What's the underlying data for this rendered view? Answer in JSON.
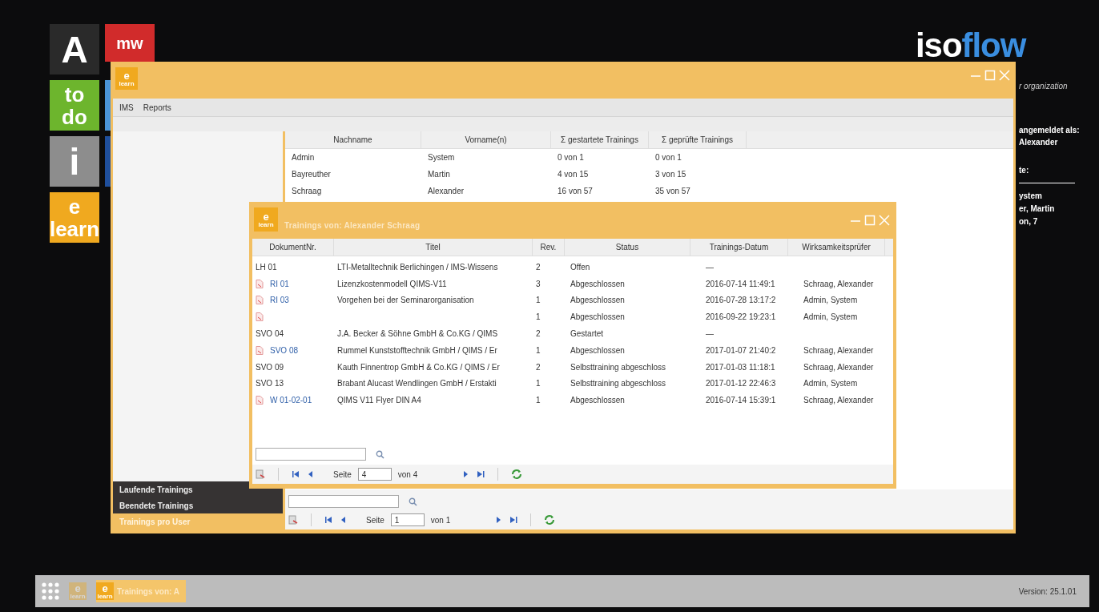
{
  "desktop": {
    "tiles": [
      {
        "lines": [
          "A"
        ],
        "color": "#2a2a2a"
      },
      {
        "lines": [
          "mw"
        ],
        "color": "#d12b2b"
      },
      {
        "lines": [
          "to",
          "do"
        ],
        "color": "#6db52d"
      },
      {
        "color": "#4b93d8"
      },
      {
        "lines": [
          "i"
        ],
        "color": "#8d8d8d"
      },
      {
        "color": "#1f4f9c"
      },
      {
        "lines": [
          "e",
          "learn"
        ],
        "color": "#f0a91f"
      }
    ],
    "logo": {
      "part_1": "iso",
      "part_2": "flow",
      "tagline": "r organization"
    },
    "side_panel": {
      "login_label": "angemeldet als:",
      "user": "Alexander",
      "section_title": "te:",
      "entries": [
        "ystem",
        "er, Martin",
        "on, 7"
      ]
    }
  },
  "main_window": {
    "icon": {
      "top": "e",
      "bottom": "learn"
    },
    "menu": [
      "IMS",
      "Reports"
    ],
    "table": {
      "columns": [
        "Nachname",
        "Vorname(n)",
        "Σ gestartete Trainings",
        "Σ geprüfte Trainings"
      ],
      "rows": [
        [
          "Admin",
          "System",
          "0 von 1",
          "0 von 1"
        ],
        [
          "Bayreuther",
          "Martin",
          "4 von 15",
          "3 von 15"
        ],
        [
          "Schraag",
          "Alexander",
          "16 von 57",
          "35 von 57"
        ]
      ]
    },
    "nav": [
      {
        "label": "Laufende Trainings",
        "selected": false
      },
      {
        "label": "Beendete Trainings",
        "selected": false
      },
      {
        "label": "Trainings pro User",
        "selected": true
      }
    ],
    "pager": {
      "label": "Seite",
      "page": "1",
      "of": "von 1"
    }
  },
  "child_window": {
    "icon": {
      "top": "e",
      "bottom": "learn"
    },
    "title": "Trainings von: Alexander Schraag",
    "table": {
      "columns": [
        "DokumentNr.",
        "Titel",
        "Rev.",
        "Status",
        "Trainings-Datum",
        "Wirksamkeitsprüfer"
      ],
      "rows": [
        {
          "linked": false,
          "doc": "LH 01",
          "title": "LTI-Metalltechnik Berlichingen / IMS-Wissens",
          "rev": "2",
          "status": "Offen",
          "date": "—"
        },
        {
          "linked": true,
          "doc": "RI 01",
          "title": "Lizenzkostenmodell QIMS-V11",
          "rev": "3",
          "status": "Abgeschlossen",
          "date": "2016-07-14 11:49:1",
          "checker": "Schraag, Alexander"
        },
        {
          "linked": true,
          "doc": "RI 03",
          "title": "Vorgehen bei der Seminarorganisation",
          "rev": "1",
          "status": "Abgeschlossen",
          "date": "2016-07-28 13:17:2",
          "checker": "Admin, System"
        },
        {
          "linked": true,
          "rev": "1",
          "status": "Abgeschlossen",
          "date": "2016-09-22 19:23:1",
          "checker": "Admin, System"
        },
        {
          "linked": false,
          "doc": "SVO 04",
          "title": "J.A. Becker & Söhne GmbH & Co.KG / QIMS",
          "rev": "2",
          "status": "Gestartet",
          "date": "—"
        },
        {
          "linked": true,
          "doc": "SVO 08",
          "title": "Rummel Kunststofftechnik GmbH / QIMS / Er",
          "rev": "1",
          "status": "Abgeschlossen",
          "date": "2017-01-07 21:40:2",
          "checker": "Schraag, Alexander"
        },
        {
          "linked": false,
          "doc": "SVO 09",
          "title": "Kauth Finnentrop GmbH & Co.KG / QIMS / Er",
          "rev": "2",
          "status": "Selbsttraining abgeschloss",
          "date": "2017-01-03 11:18:1",
          "checker": "Schraag, Alexander"
        },
        {
          "linked": false,
          "doc": "SVO 13",
          "title": "Brabant Alucast Wendlingen GmbH / Erstakti",
          "rev": "1",
          "status": "Selbsttraining abgeschloss",
          "date": "2017-01-12 22:46:3",
          "checker": "Admin, System"
        },
        {
          "linked": true,
          "doc": "W 01-02-01",
          "title": "QIMS V11 Flyer DIN A4",
          "rev": "1",
          "status": "Abgeschlossen",
          "date": "2016-07-14 15:39:1",
          "checker": "Schraag, Alexander"
        }
      ]
    },
    "pager": {
      "label": "Seite",
      "page": "4",
      "of": "von 4"
    }
  },
  "taskbar": {
    "items": [
      {
        "top": "e",
        "bottom": "learn",
        "active": false
      },
      {
        "top": "e",
        "bottom": "learn",
        "label": "Trainings von: A",
        "active": true
      }
    ],
    "version": "Version: 25.1.01"
  }
}
